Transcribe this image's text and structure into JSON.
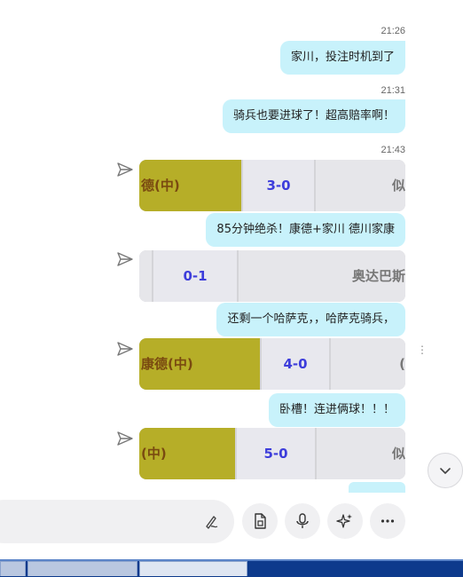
{
  "messages": [
    {
      "time": "21:26",
      "text": "家川，投注时机到了"
    },
    {
      "time": "21:31",
      "text": "骑兵也要进球了！超高赔率啊！"
    },
    {
      "time": "21:43"
    },
    {
      "card": {
        "team": "德(中)",
        "score": "3-0",
        "rest": "似"
      }
    },
    {
      "text": "85分钟绝杀！康德+家川     德川家康"
    },
    {
      "card": {
        "team": "",
        "score": "0-1",
        "rest": "奥达巴斯"
      }
    },
    {
      "text": "还剩一个哈萨克，，哈萨克骑兵，"
    },
    {
      "card": {
        "team": "康德(中)",
        "score": "4-0",
        "rest": "("
      }
    },
    {
      "text": "卧槽！连进俩球！！！"
    },
    {
      "card": {
        "team": "(中)",
        "score": "5-0",
        "rest": "似"
      }
    }
  ],
  "icons": {
    "send": "send-icon",
    "scroll_down": "chevron-down-icon",
    "input_tool": "handwriting-icon",
    "file": "file-icon",
    "mic": "microphone-icon",
    "sparkle": "sparkle-icon",
    "more": "more-icon"
  },
  "colors": {
    "bubble": "#c8f2fb",
    "card_olive": "#b6ae28",
    "score_text": "#3d3ddb",
    "taskbar": "#0d3a8c"
  }
}
